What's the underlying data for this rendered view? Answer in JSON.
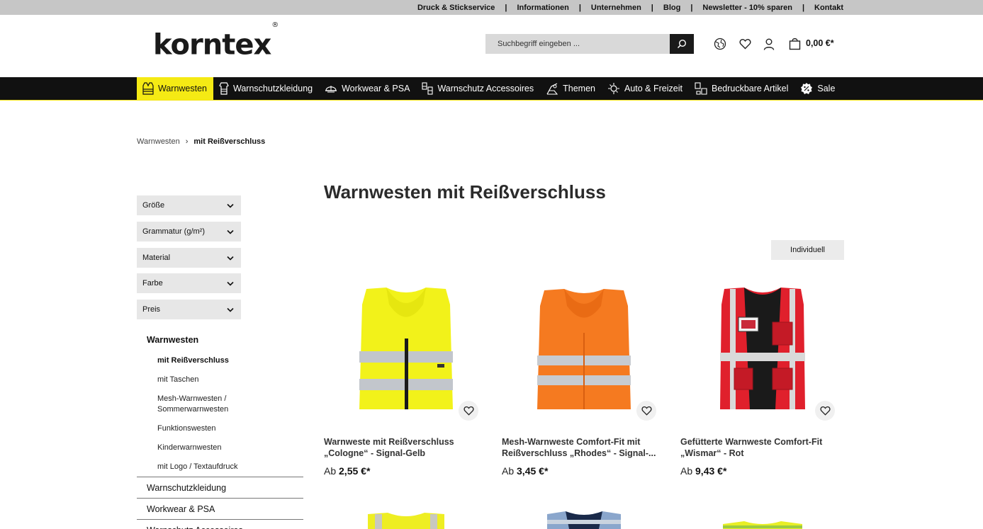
{
  "topbar": {
    "links": [
      "Druck & Stickservice",
      "Informationen",
      "Unternehmen",
      "Blog",
      "Newsletter - 10% sparen",
      "Kontakt"
    ],
    "separator": "|"
  },
  "header": {
    "logo": "korntex",
    "logo_mark": "®",
    "search_placeholder": "Suchbegriff eingeben ...",
    "cart_total": "0,00 €*"
  },
  "nav": {
    "items": [
      {
        "label": "Warnwesten",
        "icon": "vest-icon",
        "active": true
      },
      {
        "label": "Warnschutzkleidung",
        "icon": "jacket-icon"
      },
      {
        "label": "Workwear & PSA",
        "icon": "helmet-icon"
      },
      {
        "label": "Warnschutz Accessoires",
        "icon": "accessories-icon"
      },
      {
        "label": "Themen",
        "icon": "themes-icon"
      },
      {
        "label": "Auto & Freizeit",
        "icon": "car-icon"
      },
      {
        "label": "Bedruckbare Artikel",
        "icon": "print-icon"
      },
      {
        "label": "Sale",
        "icon": "sale-icon"
      }
    ],
    "accent": "#f5ea14"
  },
  "breadcrumb": {
    "parent": "Warnwesten",
    "separator": "›",
    "current": "mit Reißverschluss"
  },
  "filters": [
    "Größe",
    "Grammatur (g/m²)",
    "Material",
    "Farbe",
    "Preis"
  ],
  "categories": {
    "title": "Warnwesten",
    "sub": [
      "mit Reißverschluss",
      "mit Taschen",
      "Mesh-Warnwesten / Sommerwarnwesten",
      "Funktionswesten",
      "Kinderwarnwesten",
      "mit Logo / Textaufdruck"
    ],
    "sub_lines": [
      [
        "mit Reißverschluss"
      ],
      [
        "mit Taschen"
      ],
      [
        "Mesh-Warnwesten /",
        "Sommerwarnwesten"
      ],
      [
        "Funktionswesten"
      ],
      [
        "Kinderwarnwesten"
      ],
      [
        "mit Logo / Textaufdruck"
      ]
    ],
    "main": [
      "Warnschutzkleidung",
      "Workwear & PSA",
      "Warnschutz Accessoires"
    ]
  },
  "main": {
    "title": "Warnwesten mit Reißverschluss",
    "sort_label": "Individuell"
  },
  "products": [
    {
      "name_lines": [
        "Warnweste mit Reißverschluss",
        "„Cologne“ - Signal-Gelb"
      ],
      "price_prefix": "Ab",
      "price": "2,55 €*",
      "color": "#f2f21a"
    },
    {
      "name_lines": [
        "Mesh-Warnweste Comfort-Fit mit",
        "Reißverschluss „Rhodes“ - Signal-..."
      ],
      "price_prefix": "Ab",
      "price": "3,45 €*",
      "color": "#f57a20"
    },
    {
      "name_lines": [
        "Gefütterte Warnweste Comfort-Fit",
        "„Wismar“ - Rot"
      ],
      "price_prefix": "Ab",
      "price": "9,43 €*",
      "color": "#e0202c"
    }
  ]
}
